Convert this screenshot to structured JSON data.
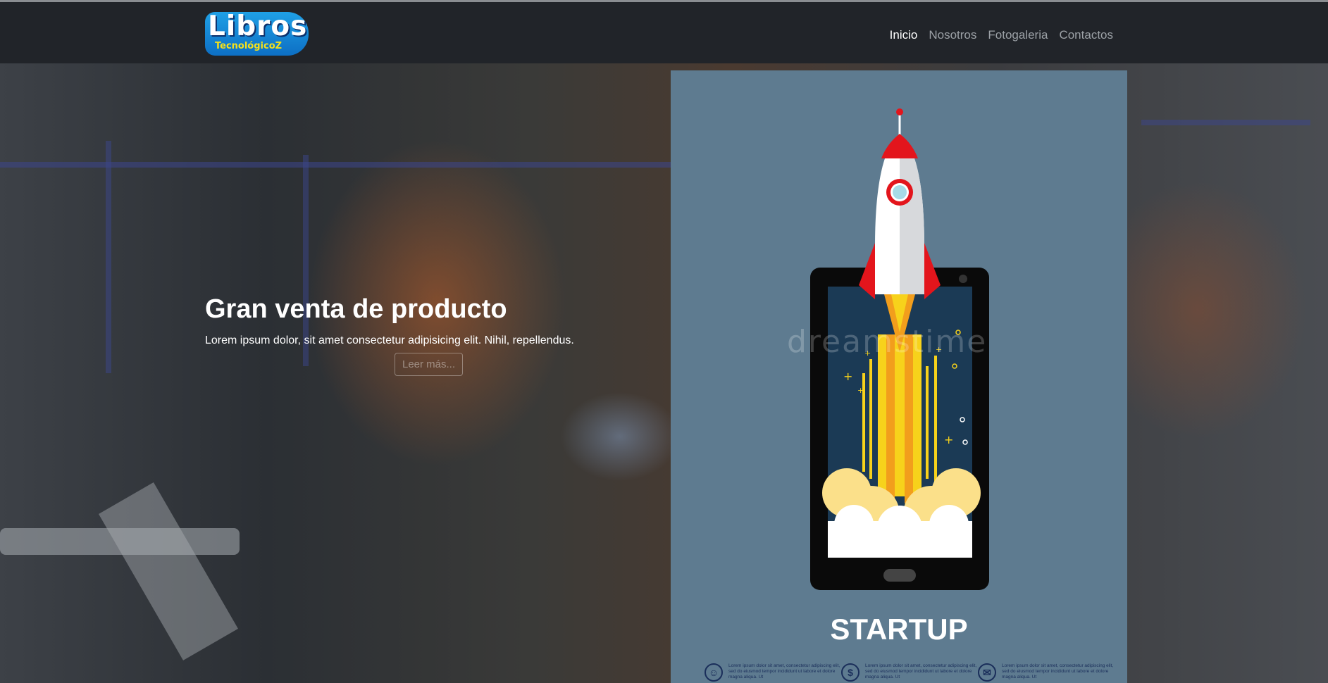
{
  "logo": {
    "main": "Libros",
    "sub": "TecnológicoZ"
  },
  "nav": {
    "items": [
      "Inicio",
      "Nosotros",
      "Fotogaleria",
      "Contactos"
    ],
    "active": "Inicio"
  },
  "hero": {
    "title": "Gran venta de producto",
    "text": "Lorem ipsum dolor, sit amet consectetur adipisicing elit. Nihil, repellendus.",
    "button": "Leer más..."
  },
  "promo": {
    "watermark": "dreamstime",
    "title": "STARTUP",
    "features": [
      {
        "icon": "people-icon",
        "glyph": "☺",
        "text": "Lorem ipsum dolor sit amet, consectetur adipiscing elit, sed do eiusmod tempor incididunt ut labore et dolore magna aliqua. Ut"
      },
      {
        "icon": "dollar-icon",
        "glyph": "$",
        "text": "Lorem ipsum dolor sit amet, consectetur adipiscing elit, sed do eiusmod tempor incididunt ut labore et dolore magna aliqua. Ut"
      },
      {
        "icon": "mail-icon",
        "glyph": "✉",
        "text": "Lorem ipsum dolor sit amet, consectetur adipiscing elit, sed do eiusmod tempor incididunt ut labore et dolore magna aliqua. Ut"
      }
    ]
  },
  "colors": {
    "navbar": "#212429",
    "panel": "#5e7b90",
    "rocket_red": "#e3151c",
    "flame_yellow": "#f7d21b"
  }
}
